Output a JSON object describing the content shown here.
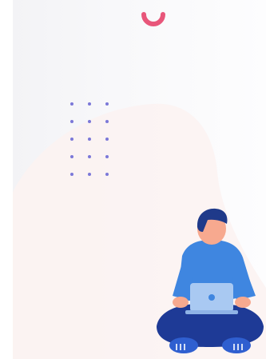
{
  "scene": {
    "background_color": "#ffffff",
    "panel_color": "#f5f5f7",
    "blob_color": "#fbf2f1",
    "loader": {
      "icon": "loading-spinner-icon",
      "color": "#e8567a"
    },
    "dot_grid": {
      "icon": "dot-grid-decoration",
      "color": "#7b78d8",
      "rows": 5,
      "columns": 3
    },
    "illustration": {
      "icon": "person-with-laptop-illustration",
      "hair_color": "#1f3a8a",
      "skin_color": "#f7a98f",
      "shirt_color": "#3f86e0",
      "pants_color": "#1e3a96",
      "laptop_color": "#a9c9f2"
    }
  }
}
